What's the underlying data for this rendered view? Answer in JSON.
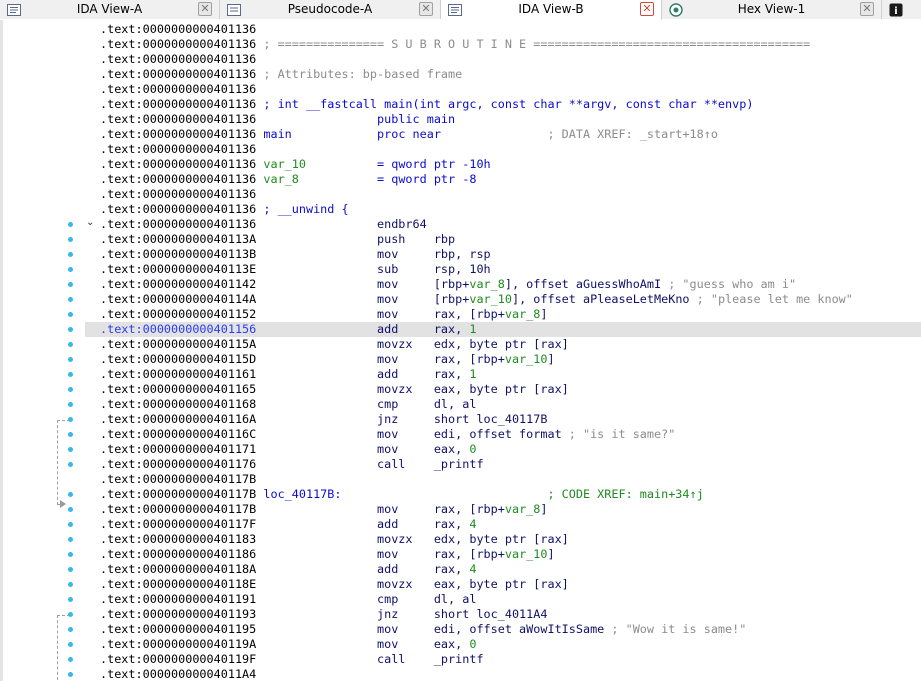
{
  "tabs": [
    {
      "label": "IDA View-A",
      "icon": "ida-view-icon",
      "active": false
    },
    {
      "label": "Pseudocode-A",
      "icon": "pseudocode-icon",
      "active": false
    },
    {
      "label": "IDA View-B",
      "icon": "ida-view-icon",
      "active": true
    },
    {
      "label": "Hex View-1",
      "icon": "hex-view-icon",
      "active": false
    },
    {
      "label": "",
      "icon": "structures-icon",
      "active": false
    }
  ],
  "colors": {
    "accent_dot": "#35b8ec",
    "selection": "#e2e2e2",
    "keyword": "#0b0bd0",
    "comment": "#8c8c8c",
    "xref": "#1f8a1f"
  },
  "listing": [
    {
      "addr": ".text:0000000000401136",
      "segs": []
    },
    {
      "addr": ".text:0000000000401136",
      "segs": [
        {
          "t": " ; =============== S U B R O U T I N E =======================================",
          "c": "c-gray"
        }
      ]
    },
    {
      "addr": ".text:0000000000401136",
      "segs": []
    },
    {
      "addr": ".text:0000000000401136",
      "segs": [
        {
          "t": " ; Attributes: bp-based frame",
          "c": "c-gray"
        }
      ]
    },
    {
      "addr": ".text:0000000000401136",
      "segs": []
    },
    {
      "addr": ".text:0000000000401136",
      "segs": [
        {
          "t": " ; int __fastcall main(int argc, const char **argv, const char **envp)",
          "c": "c-blue"
        }
      ]
    },
    {
      "addr": ".text:0000000000401136",
      "segs": [
        {
          "t": "                 public main",
          "c": "c-blue"
        }
      ]
    },
    {
      "addr": ".text:0000000000401136",
      "segs": [
        {
          "t": " main",
          "c": "c-blue"
        },
        {
          "t": "            proc near               ",
          "c": "c-blue"
        },
        {
          "t": "; DATA XREF: _start+18↑o",
          "c": "c-gray"
        }
      ]
    },
    {
      "addr": ".text:0000000000401136",
      "segs": []
    },
    {
      "addr": ".text:0000000000401136",
      "segs": [
        {
          "t": " var_10",
          "c": "c-var"
        },
        {
          "t": "          = qword ptr -10h",
          "c": "c-blue"
        }
      ]
    },
    {
      "addr": ".text:0000000000401136",
      "segs": [
        {
          "t": " var_8",
          "c": "c-var"
        },
        {
          "t": "           = qword ptr -8",
          "c": "c-blue"
        }
      ]
    },
    {
      "addr": ".text:0000000000401136",
      "segs": []
    },
    {
      "addr": ".text:0000000000401136",
      "segs": [
        {
          "t": " ; __unwind {",
          "c": "c-blue"
        }
      ]
    },
    {
      "addr": ".text:0000000000401136",
      "segs": [
        {
          "t": "                 endbr64",
          "c": "c-navy"
        }
      ]
    },
    {
      "addr": ".text:000000000040113A",
      "segs": [
        {
          "t": "                 push    rbp",
          "c": "c-navy"
        }
      ]
    },
    {
      "addr": ".text:000000000040113B",
      "segs": [
        {
          "t": "                 mov     rbp, rsp",
          "c": "c-navy"
        }
      ]
    },
    {
      "addr": ".text:000000000040113E",
      "segs": [
        {
          "t": "                 sub     rsp, 10h",
          "c": "c-navy"
        }
      ]
    },
    {
      "addr": ".text:0000000000401142",
      "segs": [
        {
          "t": "                 mov     [rbp+",
          "c": "c-navy"
        },
        {
          "t": "var_8",
          "c": "c-var"
        },
        {
          "t": "], offset aGuessWhoAmI",
          "c": "c-navy"
        },
        {
          "t": " ; \"guess who am i\"",
          "c": "c-gray"
        }
      ]
    },
    {
      "addr": ".text:000000000040114A",
      "segs": [
        {
          "t": "                 mov     [rbp+",
          "c": "c-navy"
        },
        {
          "t": "var_10",
          "c": "c-var"
        },
        {
          "t": "], offset aPleaseLetMeKno",
          "c": "c-navy"
        },
        {
          "t": " ; \"please let me know\"",
          "c": "c-gray"
        }
      ]
    },
    {
      "addr": ".text:0000000000401152",
      "segs": [
        {
          "t": "                 mov     rax, [rbp+",
          "c": "c-navy"
        },
        {
          "t": "var_8",
          "c": "c-var"
        },
        {
          "t": "]",
          "c": "c-navy"
        }
      ]
    },
    {
      "addr": ".text:0000000000401156",
      "sel": true,
      "segs": [
        {
          "t": "                 add     rax, ",
          "c": "c-navy"
        },
        {
          "t": "1",
          "c": "c-var"
        }
      ]
    },
    {
      "addr": ".text:000000000040115A",
      "segs": [
        {
          "t": "                 movzx   edx, byte ptr [rax]",
          "c": "c-navy"
        }
      ]
    },
    {
      "addr": ".text:000000000040115D",
      "segs": [
        {
          "t": "                 mov     rax, [rbp+",
          "c": "c-navy"
        },
        {
          "t": "var_10",
          "c": "c-var"
        },
        {
          "t": "]",
          "c": "c-navy"
        }
      ]
    },
    {
      "addr": ".text:0000000000401161",
      "segs": [
        {
          "t": "                 add     rax, ",
          "c": "c-navy"
        },
        {
          "t": "1",
          "c": "c-var"
        }
      ]
    },
    {
      "addr": ".text:0000000000401165",
      "segs": [
        {
          "t": "                 movzx   eax, byte ptr [rax]",
          "c": "c-navy"
        }
      ]
    },
    {
      "addr": ".text:0000000000401168",
      "segs": [
        {
          "t": "                 cmp     dl, al",
          "c": "c-navy"
        }
      ]
    },
    {
      "addr": ".text:000000000040116A",
      "segs": [
        {
          "t": "                 jnz     short loc_40117B",
          "c": "c-navy"
        }
      ]
    },
    {
      "addr": ".text:000000000040116C",
      "segs": [
        {
          "t": "                 mov     edi, offset format",
          "c": "c-navy"
        },
        {
          "t": " ; \"is it same?\"",
          "c": "c-gray"
        }
      ]
    },
    {
      "addr": ".text:0000000000401171",
      "segs": [
        {
          "t": "                 mov     eax, ",
          "c": "c-navy"
        },
        {
          "t": "0",
          "c": "c-var"
        }
      ]
    },
    {
      "addr": ".text:0000000000401176",
      "segs": [
        {
          "t": "                 call    _printf",
          "c": "c-navy"
        }
      ]
    },
    {
      "addr": ".text:000000000040117B",
      "segs": []
    },
    {
      "addr": ".text:000000000040117B",
      "segs": [
        {
          "t": " loc_40117B:",
          "c": "c-blue"
        },
        {
          "t": "                             ",
          "c": "c-blue"
        },
        {
          "t": "; CODE XREF: main+34↑j",
          "c": "c-green"
        }
      ]
    },
    {
      "addr": ".text:000000000040117B",
      "segs": [
        {
          "t": "                 mov     rax, [rbp+",
          "c": "c-navy"
        },
        {
          "t": "var_8",
          "c": "c-var"
        },
        {
          "t": "]",
          "c": "c-navy"
        }
      ]
    },
    {
      "addr": ".text:000000000040117F",
      "segs": [
        {
          "t": "                 add     rax, ",
          "c": "c-navy"
        },
        {
          "t": "4",
          "c": "c-var"
        }
      ]
    },
    {
      "addr": ".text:0000000000401183",
      "segs": [
        {
          "t": "                 movzx   edx, byte ptr [rax]",
          "c": "c-navy"
        }
      ]
    },
    {
      "addr": ".text:0000000000401186",
      "segs": [
        {
          "t": "                 mov     rax, [rbp+",
          "c": "c-navy"
        },
        {
          "t": "var_10",
          "c": "c-var"
        },
        {
          "t": "]",
          "c": "c-navy"
        }
      ]
    },
    {
      "addr": ".text:000000000040118A",
      "segs": [
        {
          "t": "                 add     rax, ",
          "c": "c-navy"
        },
        {
          "t": "4",
          "c": "c-var"
        }
      ]
    },
    {
      "addr": ".text:000000000040118E",
      "segs": [
        {
          "t": "                 movzx   eax, byte ptr [rax]",
          "c": "c-navy"
        }
      ]
    },
    {
      "addr": ".text:0000000000401191",
      "segs": [
        {
          "t": "                 cmp     dl, al",
          "c": "c-navy"
        }
      ]
    },
    {
      "addr": ".text:0000000000401193",
      "segs": [
        {
          "t": "                 jnz     short loc_4011A4",
          "c": "c-navy"
        }
      ]
    },
    {
      "addr": ".text:0000000000401195",
      "segs": [
        {
          "t": "                 mov     edi, offset aWowItIsSame",
          "c": "c-navy"
        },
        {
          "t": " ; \"Wow it is same!\"",
          "c": "c-gray"
        }
      ]
    },
    {
      "addr": ".text:000000000040119A",
      "segs": [
        {
          "t": "                 mov     eax, ",
          "c": "c-navy"
        },
        {
          "t": "0",
          "c": "c-var"
        }
      ]
    },
    {
      "addr": ".text:000000000040119F",
      "segs": [
        {
          "t": "                 call    _printf",
          "c": "c-navy"
        }
      ]
    },
    {
      "addr": ".text:00000000004011A4",
      "segs": []
    }
  ]
}
